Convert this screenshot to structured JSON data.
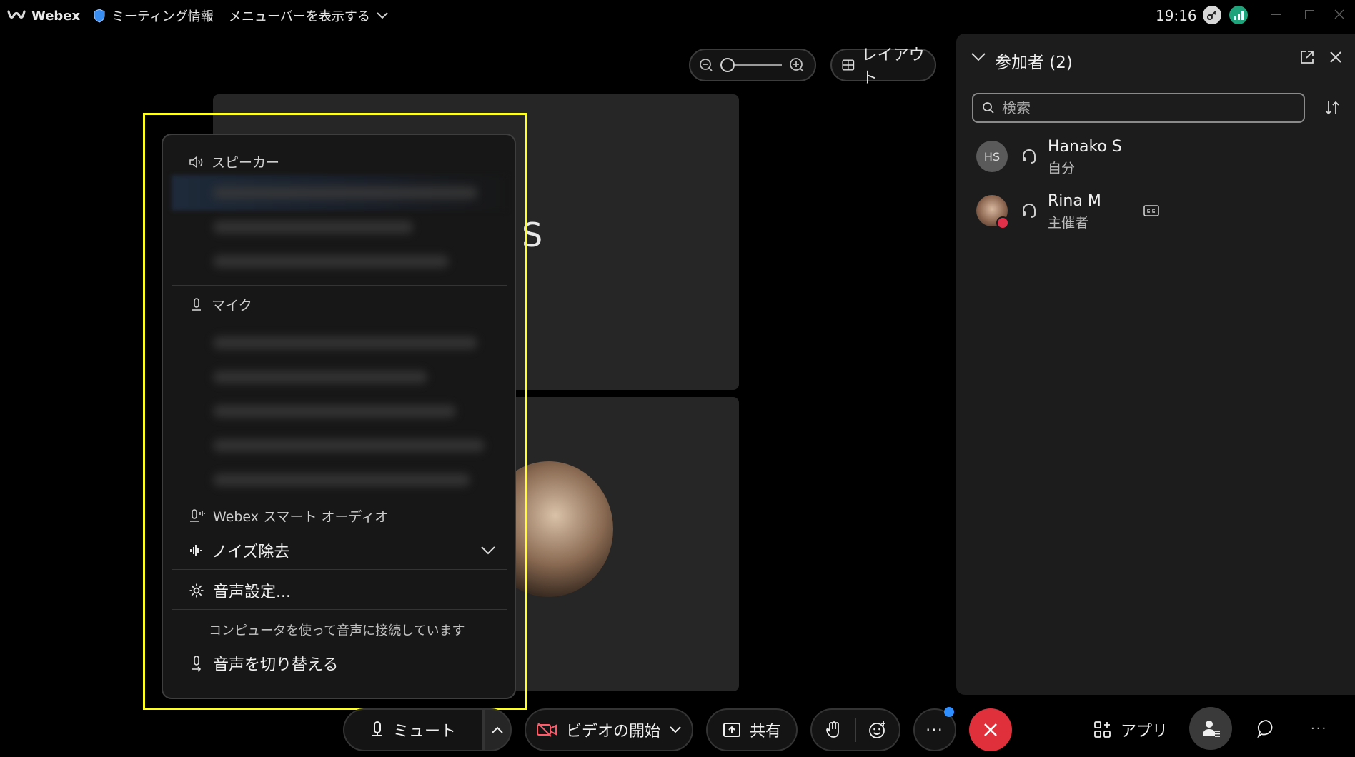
{
  "titlebar": {
    "app_name": "Webex",
    "meeting_info": "ミーティング情報",
    "menu_bar_toggle": "メニューバーを表示する",
    "time": "19:16"
  },
  "stage": {
    "tile_initial": "S",
    "layout_label": "レイアウト"
  },
  "panel": {
    "title": "参加者 (2)",
    "search_placeholder": "検索",
    "participants": [
      {
        "initials": "HS",
        "name": "Hanako S",
        "role": "自分"
      },
      {
        "initials": "",
        "name": "Rina M",
        "role": "主催者"
      }
    ]
  },
  "audio_menu": {
    "speaker_header": "スピーカー",
    "mic_header": "マイク",
    "smart_audio_header": "Webex スマート オーディオ",
    "noise_removal": "ノイズ除去",
    "audio_settings": "音声設定...",
    "connection_status": "コンピュータを使って音声に接続しています",
    "switch_audio": "音声を切り替える"
  },
  "toolbar": {
    "mute": "ミュート",
    "start_video": "ビデオの開始",
    "share": "共有",
    "more": "···",
    "apps": "アプリ",
    "overflow": "···"
  },
  "colors": {
    "end_call": "#e0303c",
    "highlight": "#ffff1a",
    "notification_dot": "#2f8fff",
    "signal_green": "#1fa37a"
  }
}
